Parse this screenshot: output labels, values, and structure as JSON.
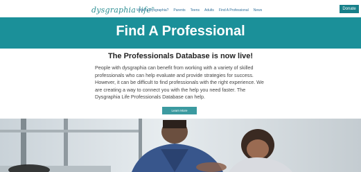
{
  "nav": {
    "logo_text": "dysgraphia life",
    "logo_mark": "®",
    "items": [
      "What Is Dysgraphia?",
      "Parents",
      "Teens",
      "Adults",
      "Find A Professional",
      "News"
    ],
    "donate_label": "Donate"
  },
  "hero": {
    "title": "Find A Professional"
  },
  "content": {
    "heading": "The Professionals Database is now live!",
    "body": "People with dysgraphia can benefit from working with a variety of skilled professionals who can help evaluate and provide strategies for success. However, it can be difficult to find professionals with the right experience. We are creating a way to connect you with the help you need faster. The Dysgraphia Life Professionals Database can help.",
    "button_label": "Learn More"
  },
  "colors": {
    "brand_teal": "#1b9099",
    "button_teal": "#3b9aa0",
    "donate_teal": "#17808a"
  }
}
